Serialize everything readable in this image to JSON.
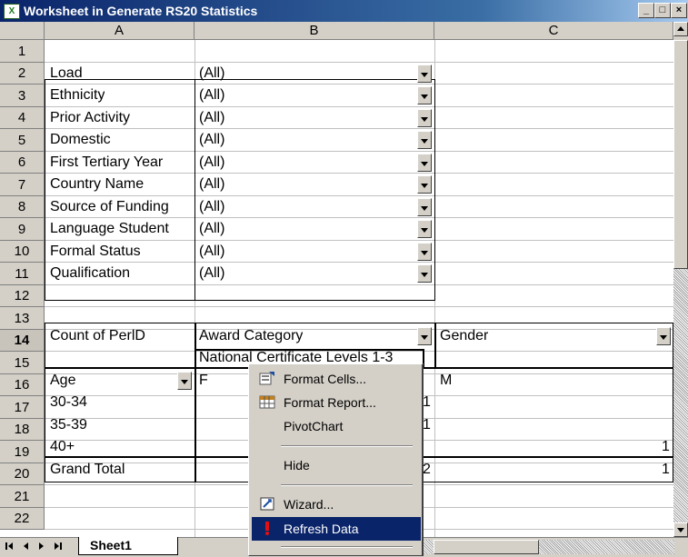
{
  "window": {
    "title": "Worksheet in Generate RS20 Statistics",
    "minimize": "_",
    "restore": "□",
    "close": "×"
  },
  "columns": [
    "A",
    "B",
    "C"
  ],
  "rows": [
    "1",
    "2",
    "3",
    "4",
    "5",
    "6",
    "7",
    "8",
    "9",
    "10",
    "11",
    "12",
    "13",
    "14",
    "15",
    "16",
    "17",
    "18",
    "19",
    "20",
    "21",
    "22"
  ],
  "active_row": "14",
  "page_fields": [
    {
      "label": "Load",
      "value": "(All)"
    },
    {
      "label": "Ethnicity",
      "value": "(All)"
    },
    {
      "label": "Prior Activity",
      "value": "(All)"
    },
    {
      "label": "Domestic",
      "value": "(All)"
    },
    {
      "label": "First Tertiary Year",
      "value": "(All)"
    },
    {
      "label": "Country Name",
      "value": "(All)"
    },
    {
      "label": "Source of Funding",
      "value": "(All)"
    },
    {
      "label": "Language Student",
      "value": "(All)"
    },
    {
      "label": "Formal Status",
      "value": "(All)"
    },
    {
      "label": "Qualification",
      "value": "(All)"
    }
  ],
  "pivot": {
    "data_field": "Count of PerlD",
    "column_field": "Award Category",
    "column_field_2": "Gender",
    "category_value": "National Certificate Levels 1-3",
    "row_field": "Age",
    "col_f": "F",
    "col_m": "M",
    "row_labels": [
      "30-34",
      "35-39",
      "40+",
      "Grand Total"
    ],
    "b_values_partial": [
      "1",
      "1",
      "",
      "2"
    ],
    "c_values": [
      "",
      "",
      "1",
      "1"
    ]
  },
  "sheet_tabs": [
    "Sheet1"
  ],
  "context_menu": {
    "items": [
      {
        "label": "Format Cells...",
        "icon": "format-cells-icon"
      },
      {
        "label": "Format Report...",
        "icon": "format-report-icon"
      },
      {
        "label": "PivotChart",
        "icon": ""
      },
      {
        "label": "Hide",
        "icon": ""
      },
      {
        "label": "Wizard...",
        "icon": "wizard-icon"
      },
      {
        "label": "Refresh Data",
        "icon": "refresh-icon",
        "highlighted": true
      }
    ]
  }
}
